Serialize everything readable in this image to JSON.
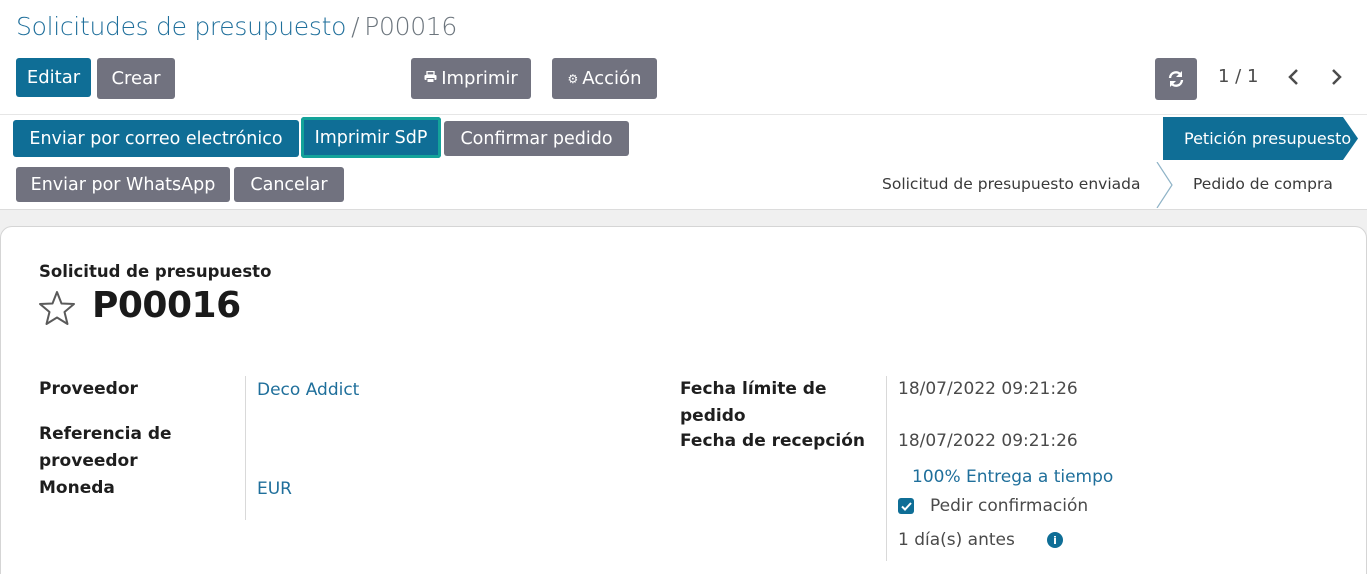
{
  "breadcrumb": {
    "parent": "Solicitudes de presupuesto",
    "separator": "/",
    "current": "P00016"
  },
  "control_panel": {
    "edit_label": "Editar",
    "create_label": "Crear",
    "print_label": "Imprimir",
    "action_label": "Acción",
    "pager": "1 / 1"
  },
  "header_buttons": {
    "send_email": "Enviar por correo electrónico",
    "print_rfq": "Imprimir SdP",
    "confirm_order": "Confirmar pedido",
    "send_whatsapp": "Enviar por WhatsApp",
    "cancel": "Cancelar"
  },
  "statusbar": {
    "steps": [
      "Petición presupuesto",
      "Solicitud de presupuesto enviada",
      "Pedido de compra"
    ],
    "active": "Petición presupuesto"
  },
  "form": {
    "doc_type": "Solicitud de presupuesto",
    "name": "P00016",
    "fields_left": {
      "vendor_label": "Proveedor",
      "vendor_value": "Deco Addict",
      "vendor_ref_label": "Referencia de proveedor",
      "currency_label": "Moneda",
      "currency_value": "EUR"
    },
    "fields_right": {
      "order_deadline_label": "Fecha límite de pedido",
      "order_deadline_value": "18/07/2022 09:21:26",
      "receipt_date_label": "Fecha de recepción",
      "receipt_date_value": "18/07/2022 09:21:26",
      "on_time_link": "100% Entrega a tiempo",
      "ask_confirmation_label": "Pedir confirmación",
      "ask_confirmation_checked": true,
      "days_before": "1 día(s) antes"
    }
  },
  "colors": {
    "primary": "#0f6e96",
    "secondary": "#71727f",
    "link": "#1f6f9b",
    "highlight": "#14a39a"
  }
}
